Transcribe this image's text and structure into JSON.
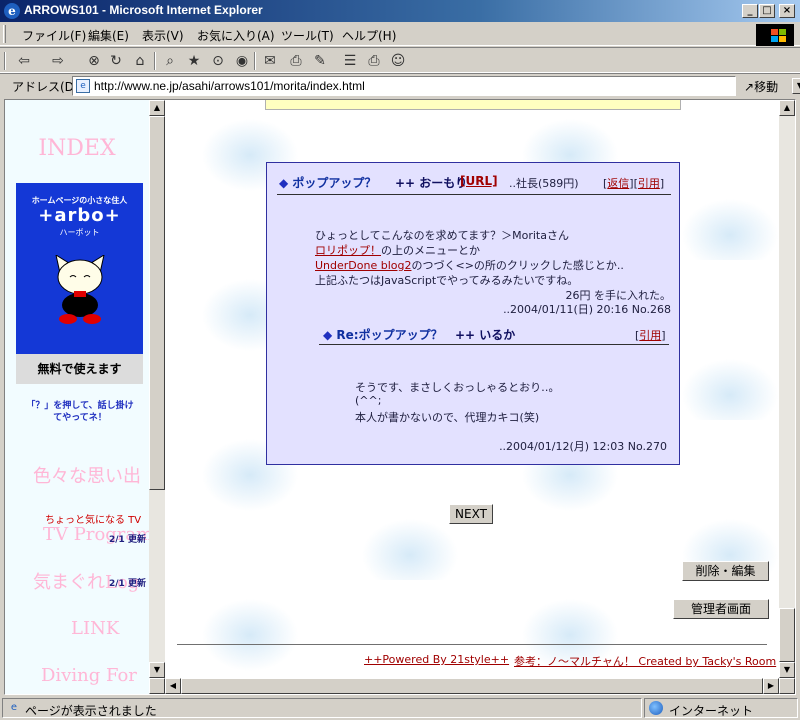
{
  "window": {
    "title": "ARROWS101 - Microsoft Internet Explorer",
    "minimize": "_",
    "maximize": "□",
    "close": "×"
  },
  "menu": {
    "items": [
      "ファイル(F)",
      "編集(E)",
      "表示(V)",
      "お気に入り(A)",
      "ツール(T)",
      "ヘルプ(H)"
    ]
  },
  "toolbar": {
    "back": "⇦",
    "forward": "⇨",
    "stop": "⊗",
    "refresh": "↻",
    "home": "⌂",
    "search": "⌕",
    "favorites": "★",
    "history": "⊙",
    "media": "◉",
    "mail": "✉",
    "print": "⎙",
    "edit": "✎",
    "discuss": "☰",
    "messenger": "☺"
  },
  "address": {
    "label": "アドレス(D)",
    "url": "http://www.ne.jp/asahi/arrows101/morita/index.html",
    "go": "移動"
  },
  "left_frame": {
    "index": "INDEX",
    "banner": {
      "sub": "ホームページの小さな住人",
      "logo": "+arbo+",
      "kana": "ハーボット",
      "footer": "無料で使えます"
    },
    "hint_line1": "「？」を押して、話し掛け",
    "hint_line2": "てやってネ！",
    "menu": {
      "memories": "色々な思い出",
      "tv_note": "ちょっと気になる TV",
      "tv_title": "TV Program",
      "update1": "2/1 更新",
      "whim_title": "気まぐれLog",
      "update2": "2/1 更新",
      "link": "LINK",
      "diving": "Diving For"
    }
  },
  "post": {
    "title": "ポップアップ？",
    "author_prefix": "++",
    "author": "おーもり",
    "url_label": "[URL]",
    "meta": "..社長(589円)",
    "reply_action": "返信",
    "quote_action": "引用",
    "lines": [
      "ひょっとしてこんなのを求めてます？＞Moritaさん",
      "の上のメニューとか",
      "のつづく<>の所のクリックした感じとか..",
      "上記ふたつはJavaScriptでやってみるみたいですね。"
    ],
    "link1": "ロリポップ！",
    "link2": "UnderDone blog2",
    "bounty": "26円 を手に入れた。",
    "stamp": "..2004/01/11(日) 20:16 No.268"
  },
  "reply": {
    "title": "Re:ポップアップ？",
    "author_prefix": "++",
    "author": "いるか",
    "quote_action": "引用",
    "lines": [
      "そうです、まさしくおっしゃるとおり‥。",
      "(^^;",
      "本人が書かないので、代理カキコ(笑)"
    ],
    "stamp": "..2004/01/12(月) 12:03 No.270"
  },
  "buttons": {
    "next": "NEXT",
    "delete_edit": "削除・編集",
    "admin": "管理者画面"
  },
  "footer": {
    "powered": "++Powered By 21style++",
    "reference": "参考：ノ～マルチャん！ Created by Tacky's Room"
  },
  "status": {
    "message": "ページが表示されました",
    "zone": "インターネット"
  }
}
